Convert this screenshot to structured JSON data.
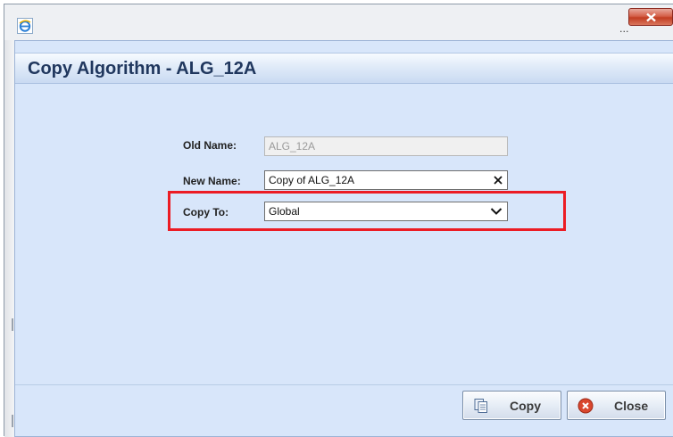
{
  "window": {
    "title_icon": "ie-icon",
    "overflow_label": "...",
    "close_icon": "close-x-icon"
  },
  "dialog": {
    "title": "Copy Algorithm - ALG_12A"
  },
  "form": {
    "old_name_label": "Old Name:",
    "old_name_value": "ALG_12A",
    "new_name_label": "New Name:",
    "new_name_value": "Copy of ALG_12A",
    "copy_to_label": "Copy To:",
    "copy_to_value": "Global"
  },
  "buttons": {
    "copy_label": "Copy",
    "copy_icon": "copy-icon",
    "close_label": "Close",
    "close_icon": "cancel-circle-icon"
  },
  "colors": {
    "dialog_background": "#d8e6fa",
    "title_text": "#20375e",
    "highlight": "#ec1c24",
    "close_button": "#c9432a"
  }
}
